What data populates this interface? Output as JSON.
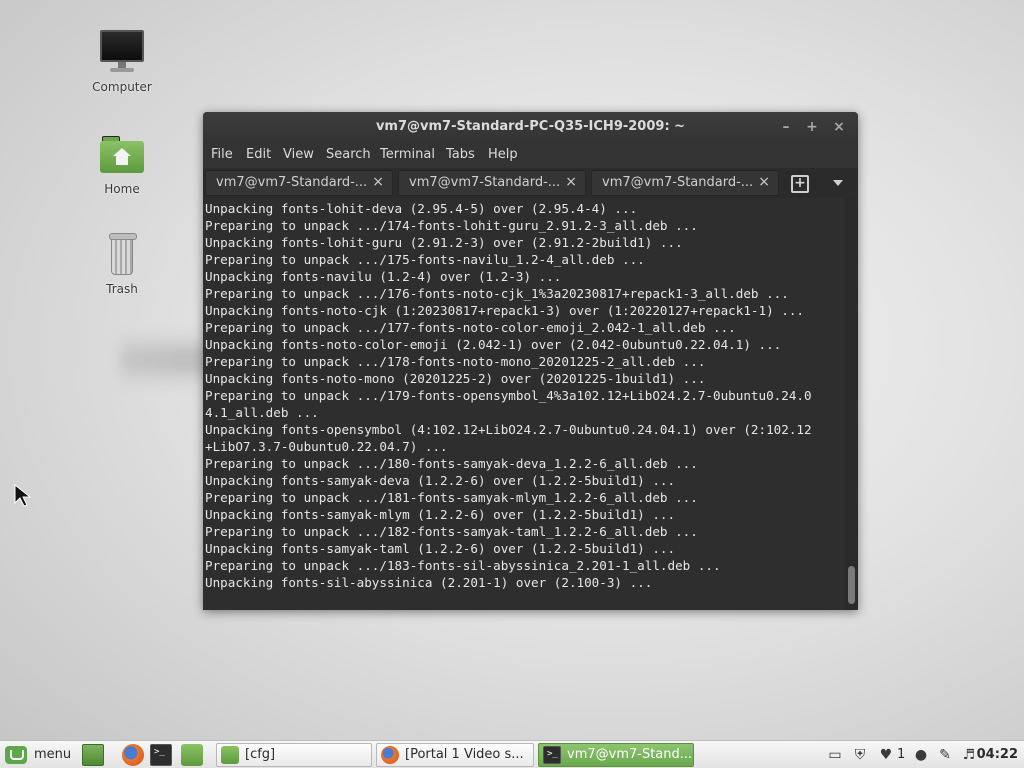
{
  "desktop": {
    "icons": [
      {
        "label": "Computer",
        "icon": "computer-icon"
      },
      {
        "label": "Home",
        "icon": "home-folder-icon"
      },
      {
        "label": "Trash",
        "icon": "trash-icon"
      }
    ]
  },
  "terminal": {
    "title": "vm7@vm7-Standard-PC-Q35-ICH9-2009: ~",
    "window_buttons": {
      "minimize": "–",
      "maximize": "+",
      "close": "×"
    },
    "menu": [
      "File",
      "Edit",
      "View",
      "Search",
      "Terminal",
      "Tabs",
      "Help"
    ],
    "tabs": [
      {
        "label": "vm7@vm7-Standard-...",
        "close": "×"
      },
      {
        "label": "vm7@vm7-Standard-...",
        "close": "×"
      },
      {
        "label": "vm7@vm7-Standard-...",
        "close": "×"
      }
    ],
    "new_tab_symbol": "+",
    "lines": [
      "Unpacking fonts-lohit-deva (2.95.4-5) over (2.95.4-4) ...",
      "Preparing to unpack .../174-fonts-lohit-guru_2.91.2-3_all.deb ...",
      "Unpacking fonts-lohit-guru (2.91.2-3) over (2.91.2-2build1) ...",
      "Preparing to unpack .../175-fonts-navilu_1.2-4_all.deb ...",
      "Unpacking fonts-navilu (1.2-4) over (1.2-3) ...",
      "Preparing to unpack .../176-fonts-noto-cjk_1%3a20230817+repack1-3_all.deb ...",
      "Unpacking fonts-noto-cjk (1:20230817+repack1-3) over (1:20220127+repack1-1) ...",
      "Preparing to unpack .../177-fonts-noto-color-emoji_2.042-1_all.deb ...",
      "Unpacking fonts-noto-color-emoji (2.042-1) over (2.042-0ubuntu0.22.04.1) ...",
      "Preparing to unpack .../178-fonts-noto-mono_20201225-2_all.deb ...",
      "Unpacking fonts-noto-mono (20201225-2) over (20201225-1build1) ...",
      "Preparing to unpack .../179-fonts-opensymbol_4%3a102.12+LibO24.2.7-0ubuntu0.24.0",
      "4.1_all.deb ...",
      "Unpacking fonts-opensymbol (4:102.12+LibO24.2.7-0ubuntu0.24.04.1) over (2:102.12",
      "+LibO7.3.7-0ubuntu0.22.04.7) ...",
      "Preparing to unpack .../180-fonts-samyak-deva_1.2.2-6_all.deb ...",
      "Unpacking fonts-samyak-deva (1.2.2-6) over (1.2.2-5build1) ...",
      "Preparing to unpack .../181-fonts-samyak-mlym_1.2.2-6_all.deb ...",
      "Unpacking fonts-samyak-mlym (1.2.2-6) over (1.2.2-5build1) ...",
      "Preparing to unpack .../182-fonts-samyak-taml_1.2.2-6_all.deb ...",
      "Unpacking fonts-samyak-taml (1.2.2-6) over (1.2.2-5build1) ...",
      "Preparing to unpack .../183-fonts-sil-abyssinica_2.201-1_all.deb ...",
      "Unpacking fonts-sil-abyssinica (2.201-1) over (2.100-3) ..."
    ]
  },
  "taskbar": {
    "menu_label": "menu",
    "windows": [
      {
        "label": "[cfg]",
        "icon": "folder-icon",
        "active": false
      },
      {
        "label": "[Portal 1 Video s...",
        "icon": "firefox-icon",
        "active": false
      },
      {
        "label": "vm7@vm7-Stand...",
        "icon": "terminal-icon",
        "active": true
      }
    ],
    "tray": {
      "notifications_count": "1",
      "clock": "04:22"
    }
  },
  "colors": {
    "terminal_bg": "#2e2e2e",
    "terminal_fg": "#e6e6e6",
    "accent_green": "#6aa84f"
  }
}
